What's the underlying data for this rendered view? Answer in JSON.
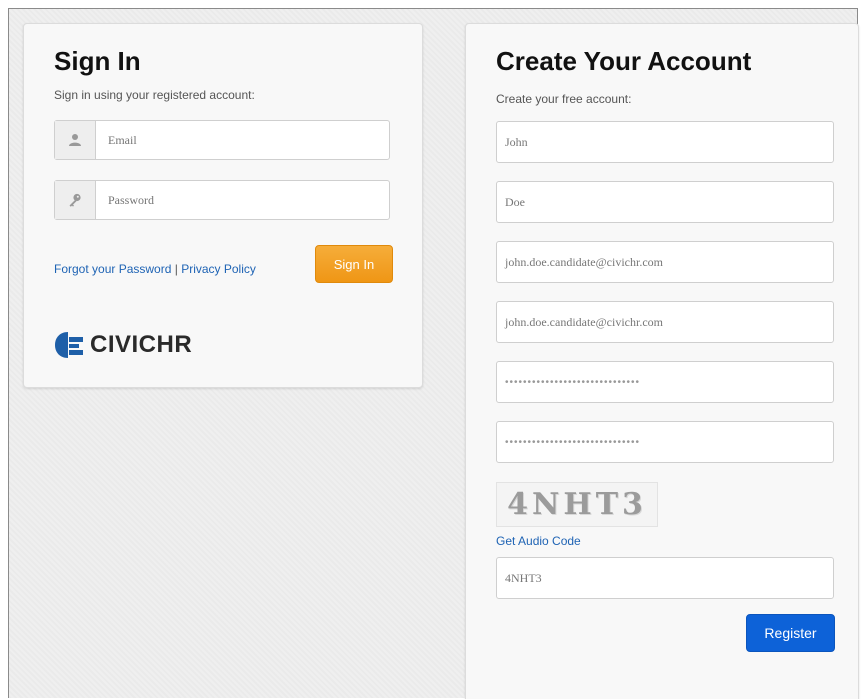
{
  "signin": {
    "title": "Sign In",
    "subtitle": "Sign in using your registered account:",
    "email_placeholder": "Email",
    "password_placeholder": "Password",
    "forgot_link": "Forgot your Password",
    "separator": " | ",
    "privacy_link": "Privacy Policy",
    "button_label": "Sign In",
    "logo_text": "CIVICHR"
  },
  "create": {
    "title": "Create Your Account",
    "subtitle": "Create your free account:",
    "first_name": "John",
    "last_name": "Doe",
    "email": "john.doe.candidate@civichr.com",
    "email_confirm": "john.doe.candidate@civichr.com",
    "password_mask": "••••••••••••••••••••••••••••••",
    "password_confirm_mask": "••••••••••••••••••••••••••••••",
    "captcha_text": "4NHT3",
    "audio_link": "Get Audio Code",
    "captcha_input": "4NHT3",
    "register_label": "Register"
  },
  "icons": {
    "email": "user-icon",
    "password": "key-icon"
  },
  "colors": {
    "signin_button": "#f09a1e",
    "register_button": "#0d62d8",
    "link": "#1e63b4",
    "logo_mark": "#1e5fa8"
  }
}
